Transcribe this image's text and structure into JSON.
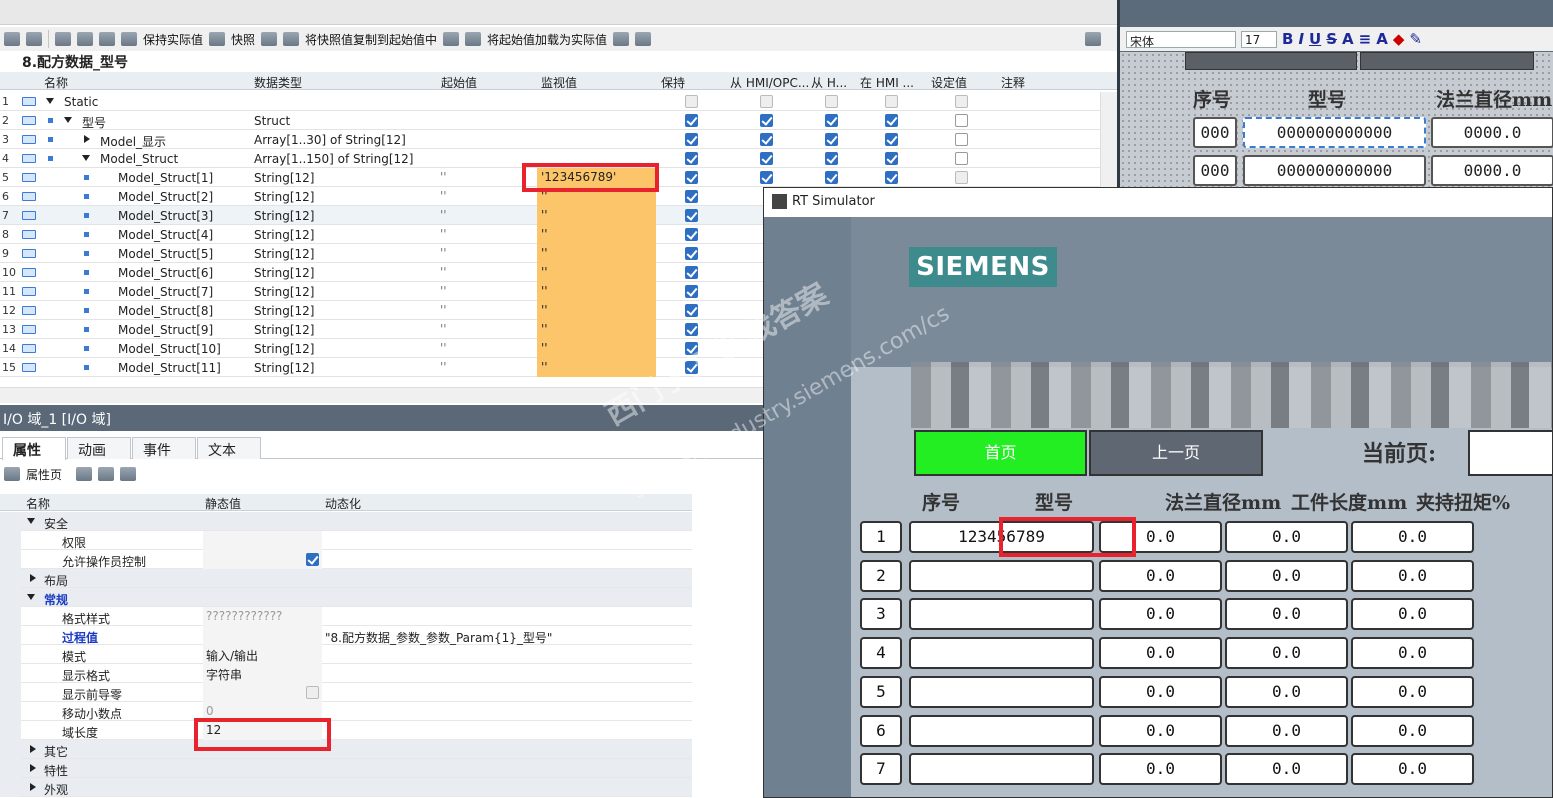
{
  "db_editor": {
    "toolbar": {
      "keep_actual": "保持实际值",
      "snapshot": "快照",
      "copy_snapshot": "将快照值复制到起始值中",
      "load_start": "将起始值加载为实际值"
    },
    "title": "8.配方数据_型号",
    "columns": [
      "名称",
      "数据类型",
      "起始值",
      "监视值",
      "保持",
      "从 HMI/OPC...",
      "从 H...",
      "在 HMI ...",
      "设定值",
      "注释"
    ],
    "rows": [
      {
        "num": "1",
        "name": "Static",
        "dtype": "",
        "start": "",
        "monitor": "",
        "checks": [
          "dis",
          "dis",
          "dis",
          "dis",
          "dis"
        ]
      },
      {
        "num": "2",
        "name": "型号",
        "dtype": "Struct",
        "start": "",
        "monitor": "",
        "checks": [
          "on",
          "on",
          "on",
          "on",
          "off"
        ]
      },
      {
        "num": "3",
        "name": "Model_显示",
        "dtype": "Array[1..30] of String[12]",
        "start": "",
        "monitor": "",
        "checks": [
          "on",
          "on",
          "on",
          "on",
          "off"
        ]
      },
      {
        "num": "4",
        "name": "Model_Struct",
        "dtype": "Array[1..150] of String[12]",
        "start": "",
        "monitor": "",
        "checks": [
          "on",
          "on",
          "on",
          "on",
          "off"
        ]
      },
      {
        "num": "5",
        "name": "Model_Struct[1]",
        "dtype": "String[12]",
        "start": "''",
        "monitor": "'123456789'",
        "checks": [
          "on",
          "on",
          "on",
          "on",
          "dis"
        ]
      },
      {
        "num": "6",
        "name": "Model_Struct[2]",
        "dtype": "String[12]",
        "start": "''",
        "monitor": "''",
        "checks": [
          "on"
        ]
      },
      {
        "num": "7",
        "name": "Model_Struct[3]",
        "dtype": "String[12]",
        "start": "''",
        "monitor": "''",
        "checks": [
          "on"
        ]
      },
      {
        "num": "8",
        "name": "Model_Struct[4]",
        "dtype": "String[12]",
        "start": "''",
        "monitor": "''",
        "checks": [
          "on"
        ]
      },
      {
        "num": "9",
        "name": "Model_Struct[5]",
        "dtype": "String[12]",
        "start": "''",
        "monitor": "''",
        "checks": [
          "on"
        ]
      },
      {
        "num": "10",
        "name": "Model_Struct[6]",
        "dtype": "String[12]",
        "start": "''",
        "monitor": "''",
        "checks": [
          "on"
        ]
      },
      {
        "num": "11",
        "name": "Model_Struct[7]",
        "dtype": "String[12]",
        "start": "''",
        "monitor": "''",
        "checks": [
          "on"
        ]
      },
      {
        "num": "12",
        "name": "Model_Struct[8]",
        "dtype": "String[12]",
        "start": "''",
        "monitor": "''",
        "checks": [
          "on"
        ]
      },
      {
        "num": "13",
        "name": "Model_Struct[9]",
        "dtype": "String[12]",
        "start": "''",
        "monitor": "''",
        "checks": [
          "on"
        ]
      },
      {
        "num": "14",
        "name": "Model_Struct[10]",
        "dtype": "String[12]",
        "start": "''",
        "monitor": "''",
        "checks": [
          "on"
        ]
      },
      {
        "num": "15",
        "name": "Model_Struct[11]",
        "dtype": "String[12]",
        "start": "''",
        "monitor": "''",
        "checks": [
          "on"
        ]
      }
    ]
  },
  "props": {
    "title": "I/O 域_1 [I/O 域]",
    "tabs": [
      "属性",
      "动画",
      "事件",
      "文本"
    ],
    "sub_label": "属性页",
    "columns": [
      "名称",
      "静态值",
      "动态化"
    ],
    "rows": [
      {
        "label": "安全",
        "group": true,
        "expand": "down",
        "value": "",
        "dyn": ""
      },
      {
        "label": "权限",
        "group": false,
        "value": "",
        "dyn": ""
      },
      {
        "label": "允许操作员控制",
        "group": false,
        "check": "on",
        "value": "",
        "dyn": ""
      },
      {
        "label": "布局",
        "group": true,
        "expand": "right",
        "value": "",
        "dyn": ""
      },
      {
        "label": "常规",
        "group": true,
        "expand": "down",
        "blue": true,
        "value": "",
        "dyn": ""
      },
      {
        "label": "格式样式",
        "group": false,
        "value": "????????????",
        "dyn": "",
        "dim": true
      },
      {
        "label": "过程值",
        "group": false,
        "blue": true,
        "value": "",
        "dyn": "\"8.配方数据_参数_参数_Param{1}_型号\""
      },
      {
        "label": "模式",
        "group": false,
        "value": "输入/输出",
        "dyn": ""
      },
      {
        "label": "显示格式",
        "group": false,
        "value": "字符串",
        "dyn": ""
      },
      {
        "label": "显示前导零",
        "group": false,
        "check": "dis",
        "value": "",
        "dyn": ""
      },
      {
        "label": "移动小数点",
        "group": false,
        "value": "0",
        "dyn": "",
        "dim": true
      },
      {
        "label": "域长度",
        "group": false,
        "value": "12",
        "dyn": ""
      },
      {
        "label": "其它",
        "group": true,
        "expand": "right",
        "value": "",
        "dyn": ""
      },
      {
        "label": "特性",
        "group": true,
        "expand": "right",
        "value": "",
        "dyn": ""
      },
      {
        "label": "外观",
        "group": true,
        "expand": "right",
        "value": "",
        "dyn": ""
      }
    ]
  },
  "wincc": {
    "font_name": "宋体",
    "font_size": "17",
    "headers": [
      "序号",
      "型号",
      "法兰直径mm"
    ],
    "rows": [
      [
        "000",
        "000000000000",
        "0000.0"
      ],
      [
        "000",
        "000000000000",
        "0000.0"
      ]
    ]
  },
  "simulator": {
    "window_title": "RT Simulator",
    "logo": "SIEMENS",
    "home_button": "首页",
    "prev_button": "上一页",
    "current_page_label": "当前页:",
    "headers": [
      "序号",
      "型号",
      "法兰直径mm",
      "工件长度mm",
      "夹持扭矩%"
    ],
    "rows": [
      [
        "1",
        "123456789",
        "0.0",
        "0.0",
        "0.0"
      ],
      [
        "2",
        "",
        "0.0",
        "0.0",
        "0.0"
      ],
      [
        "3",
        "",
        "0.0",
        "0.0",
        "0.0"
      ],
      [
        "4",
        "",
        "0.0",
        "0.0",
        "0.0"
      ],
      [
        "5",
        "",
        "0.0",
        "0.0",
        "0.0"
      ],
      [
        "6",
        "",
        "0.0",
        "0.0",
        "0.0"
      ],
      [
        "7",
        "",
        "0.0",
        "0.0",
        "0.0"
      ]
    ],
    "watermark": "西门子工业 找答案",
    "watermark_url": "support.industry.siemens.com/cs"
  },
  "colors": {
    "monitor_highlight": "#fdc569",
    "highlight_box": "#e8232d",
    "home_green": "#22ee22",
    "prev_gray": "#5f6773",
    "siemens_teal": "#3d8b8d"
  }
}
